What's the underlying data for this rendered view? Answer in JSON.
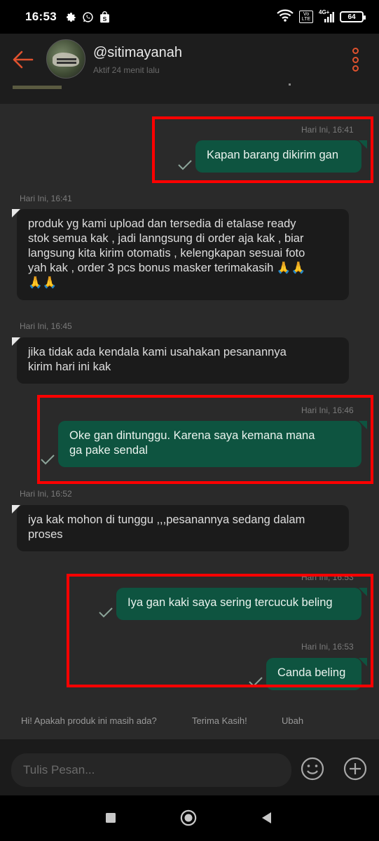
{
  "status_bar": {
    "time": "16:53",
    "left_icons": [
      "gear-icon",
      "whatsapp-icon",
      "shopping-bag-icon"
    ],
    "right_icons": [
      "wifi-icon",
      "volte-icon",
      "signal-icon"
    ],
    "network": "4G+",
    "volte": "Vo LTE",
    "battery": "64"
  },
  "header": {
    "username": "@sitimayanah",
    "last_seen": "Aktif 24 menit lalu",
    "accent_color": "#e0522e"
  },
  "messages": [
    {
      "direction": "out",
      "time": "Hari Ini, 16:41",
      "lines": [
        "Kapan barang dikirim gan"
      ]
    },
    {
      "direction": "in",
      "time": "Hari Ini, 16:41",
      "lines": [
        "produk yg kami upload dan tersedia di etalase ready",
        "stok semua kak ,  jadi lanngsung di order aja kak , biar",
        "langsung kita kirim otomatis , kelengkapan sesuai foto",
        "yah kak , order 3 pcs bonus masker terimakasih 🙏🙏",
        "🙏🙏"
      ]
    },
    {
      "direction": "in",
      "time": "Hari Ini, 16:45",
      "lines": [
        "jika tidak ada kendala kami usahakan pesanannya",
        "kirim hari ini kak"
      ]
    },
    {
      "direction": "out",
      "time": "Hari Ini, 16:46",
      "lines": [
        "Oke gan dintunggu. Karena saya kemana mana",
        "ga pake sendal"
      ]
    },
    {
      "direction": "in",
      "time": "Hari Ini, 16:52",
      "lines": [
        "iya kak mohon di tunggu ,,,pesanannya sedang dalam",
        "proses"
      ]
    },
    {
      "direction": "out",
      "time": "Hari Ini, 16:53",
      "lines": [
        "Iya gan kaki saya sering tercucuk beling"
      ]
    },
    {
      "direction": "out",
      "time": "Hari Ini, 16:53",
      "lines": [
        "Canda beling"
      ]
    }
  ],
  "quick_replies": [
    "Hi! Apakah produk ini masih ada?",
    "Terima Kasih!",
    "Ubah"
  ],
  "input": {
    "placeholder": "Tulis Pesan..."
  },
  "colors": {
    "outgoing_bubble": "#0e5440",
    "incoming_bubble": "#1b1b1b",
    "chat_background": "#2a2a2a",
    "highlight_box": "#ff0000"
  }
}
